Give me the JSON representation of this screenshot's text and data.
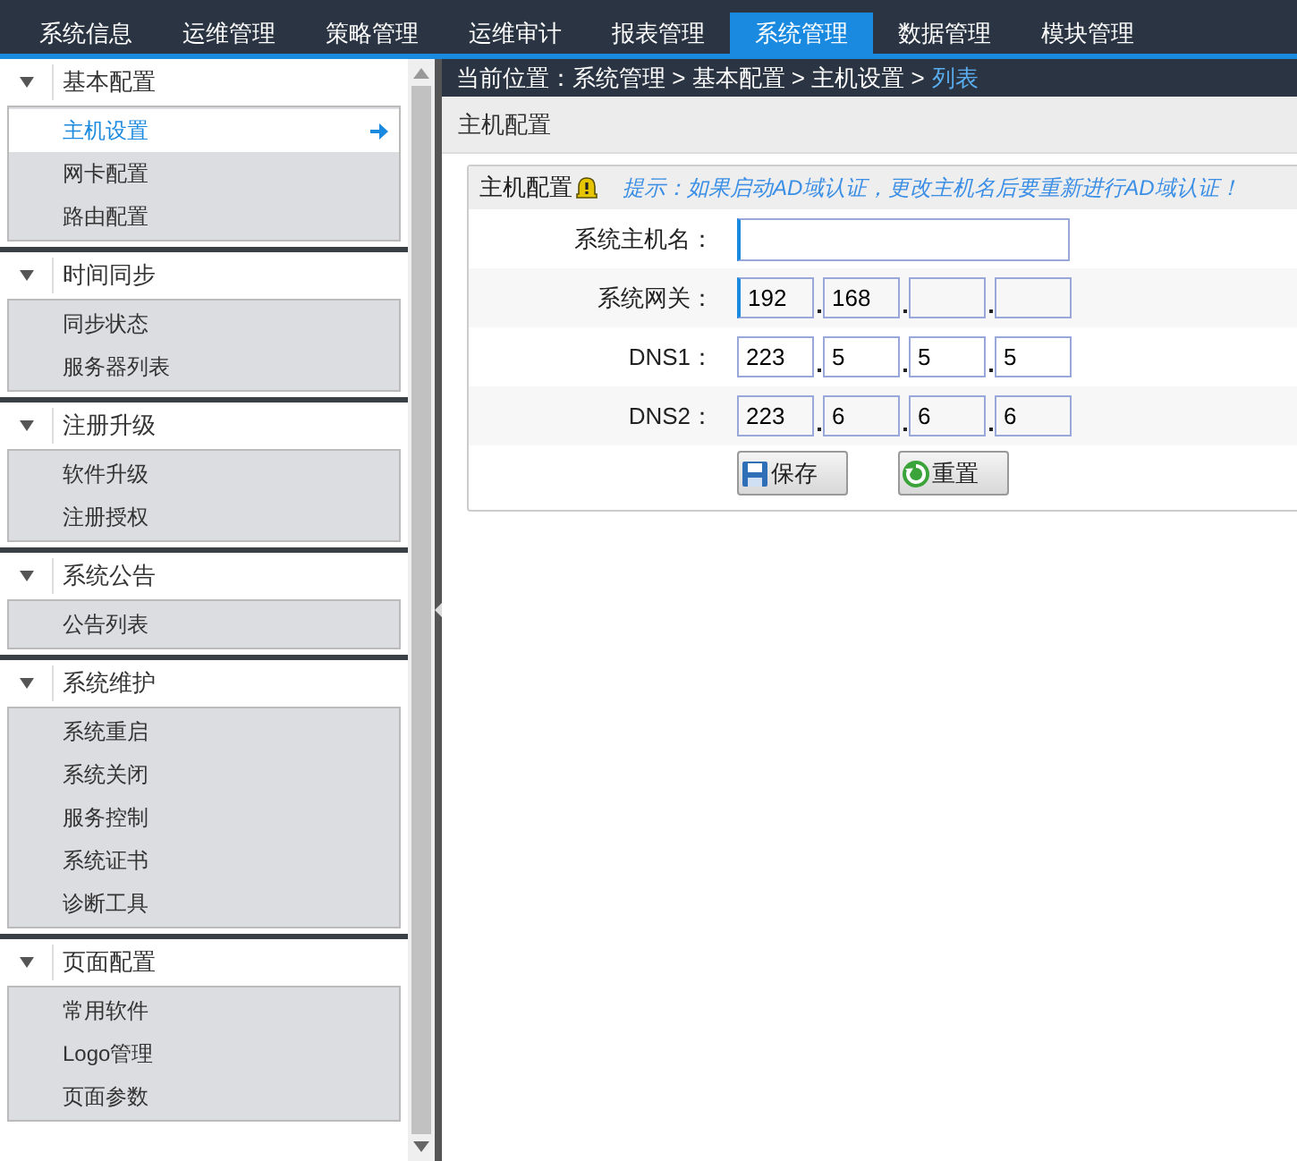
{
  "nav": [
    {
      "label": "系统信息",
      "selected": false
    },
    {
      "label": "运维管理",
      "selected": false
    },
    {
      "label": "策略管理",
      "selected": false
    },
    {
      "label": "运维审计",
      "selected": false
    },
    {
      "label": "报表管理",
      "selected": false
    },
    {
      "label": "系统管理",
      "selected": true
    },
    {
      "label": "数据管理",
      "selected": false
    },
    {
      "label": "模块管理",
      "selected": false
    }
  ],
  "sidebar": [
    {
      "title": "基本配置",
      "expanded": true,
      "items": [
        {
          "label": "主机设置",
          "selected": true
        },
        {
          "label": "网卡配置",
          "selected": false
        },
        {
          "label": "路由配置",
          "selected": false
        }
      ]
    },
    {
      "title": "时间同步",
      "expanded": true,
      "items": [
        {
          "label": "同步状态",
          "selected": false
        },
        {
          "label": "服务器列表",
          "selected": false
        }
      ]
    },
    {
      "title": "注册升级",
      "expanded": true,
      "items": [
        {
          "label": "软件升级",
          "selected": false
        },
        {
          "label": "注册授权",
          "selected": false
        }
      ]
    },
    {
      "title": "系统公告",
      "expanded": true,
      "items": [
        {
          "label": "公告列表",
          "selected": false
        }
      ]
    },
    {
      "title": "系统维护",
      "expanded": true,
      "items": [
        {
          "label": "系统重启",
          "selected": false
        },
        {
          "label": "系统关闭",
          "selected": false
        },
        {
          "label": "服务控制",
          "selected": false
        },
        {
          "label": "系统证书",
          "selected": false
        },
        {
          "label": "诊断工具",
          "selected": false
        }
      ]
    },
    {
      "title": "页面配置",
      "expanded": true,
      "items": [
        {
          "label": "常用软件",
          "selected": false
        },
        {
          "label": "Logo管理",
          "selected": false
        },
        {
          "label": "页面参数",
          "selected": false
        }
      ]
    }
  ],
  "breadcrumb": {
    "path": "当前位置：系统管理 > 基本配置 > 主机设置 >",
    "current": "列表"
  },
  "panel_title": "主机配置",
  "form": {
    "title": "主机配置",
    "hint": "提示：如果启动AD域认证，更改主机名后要重新进行AD域认证！",
    "rows": [
      {
        "label": "系统主机名：",
        "kind": "text"
      },
      {
        "label": "系统网关：",
        "kind": "ip",
        "octets": [
          {
            "kind": "filled",
            "value": "192"
          },
          {
            "kind": "filled",
            "value": "168"
          },
          {
            "kind": "blank"
          },
          {
            "kind": "blank"
          }
        ]
      },
      {
        "label": "DNS1：",
        "kind": "ip",
        "octets": [
          {
            "kind": "filled",
            "value": "223"
          },
          {
            "kind": "filled",
            "value": "5"
          },
          {
            "kind": "filled",
            "value": "5"
          },
          {
            "kind": "filled",
            "value": "5"
          }
        ]
      },
      {
        "label": "DNS2：",
        "kind": "ip",
        "octets": [
          {
            "kind": "filled",
            "value": "223"
          },
          {
            "kind": "filled",
            "value": "6"
          },
          {
            "kind": "filled",
            "value": "6"
          },
          {
            "kind": "filled",
            "value": "6"
          }
        ]
      }
    ],
    "buttons": [
      {
        "label": "保存",
        "kind": "save"
      },
      {
        "label": "重置",
        "kind": "reset"
      }
    ]
  }
}
